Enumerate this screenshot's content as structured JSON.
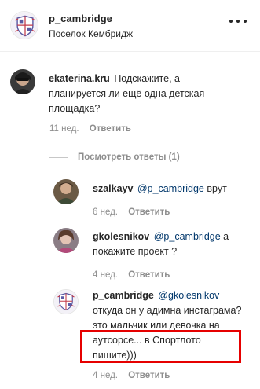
{
  "header": {
    "username": "p_cambridge",
    "location": "Поселок Кембридж"
  },
  "comments": [
    {
      "username": "ekaterina.kru",
      "text": "Подскажите, а планируется ли ещё одна детская площадка?",
      "time": "11 нед.",
      "reply": "Ответить"
    }
  ],
  "view_replies": "Посмотреть ответы (1)",
  "replies": [
    {
      "username": "szalkayv",
      "mention": "@p_cambridge",
      "text": " врут",
      "time": "6 нед.",
      "reply": "Ответить"
    },
    {
      "username": "gkolesnikov",
      "mention": "@p_cambridge",
      "text": " а покажите проект ?",
      "time": "4 нед.",
      "reply": "Ответить"
    },
    {
      "username": "p_cambridge",
      "mention": "@gkolesnikov",
      "text": " откуда он у адимна инстаграма? это мальчик или девочка на аутсорсе... в Спортлото пишите)))",
      "time": "4 нед.",
      "reply": "Ответить"
    }
  ],
  "colors": {
    "mention": "#00376b",
    "highlight": "#e60000",
    "meta": "#8e8e8e"
  }
}
